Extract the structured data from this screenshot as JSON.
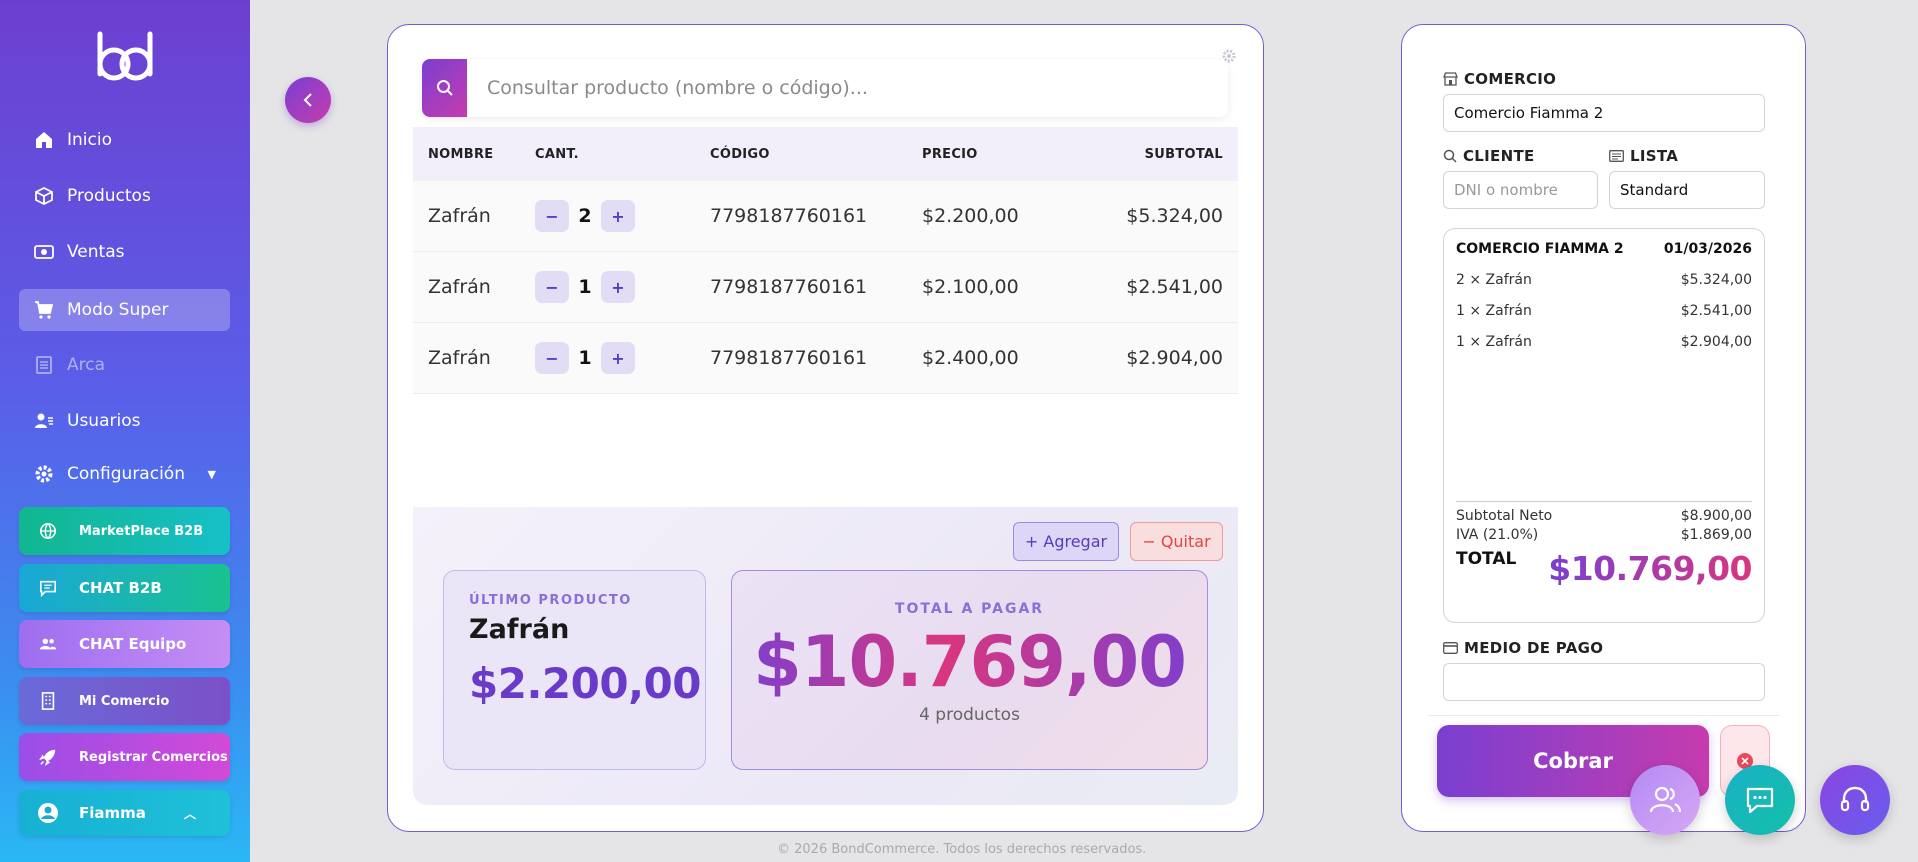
{
  "sidebar": {
    "logo": "bd",
    "items": [
      {
        "label": "Inicio",
        "icon": "home-icon"
      },
      {
        "label": "Productos",
        "icon": "box-icon"
      },
      {
        "label": "Ventas",
        "icon": "cash-icon"
      },
      {
        "label": "Modo Super",
        "icon": "cart-icon"
      },
      {
        "label": "Arca",
        "icon": "document-icon"
      },
      {
        "label": "Usuarios",
        "icon": "users-icon"
      },
      {
        "label": "Configuración",
        "icon": "gear-icon"
      }
    ],
    "pills": [
      {
        "label": "MarketPlace B2B",
        "icon": "globe-icon"
      },
      {
        "label": "CHAT B2B",
        "icon": "chat-icon"
      },
      {
        "label": "CHAT Equipo",
        "icon": "team-icon"
      },
      {
        "label": "Mi Comercio",
        "icon": "building-icon"
      },
      {
        "label": "Registrar Comercios",
        "icon": "rocket-icon"
      }
    ],
    "user": {
      "name": "Fiamma"
    }
  },
  "search": {
    "placeholder": "Consultar producto (nombre o código)..."
  },
  "table": {
    "headers": {
      "name": "NOMBRE",
      "qty": "CANT.",
      "code": "CÓDIGO",
      "price": "PRECIO",
      "subtotal": "SUBTOTAL"
    },
    "rows": [
      {
        "name": "Zafrán",
        "qty": "2",
        "code": "7798187760161",
        "price": "$2.200,00",
        "subtotal": "$5.324,00"
      },
      {
        "name": "Zafrán",
        "qty": "1",
        "code": "7798187760161",
        "price": "$2.100,00",
        "subtotal": "$2.541,00"
      },
      {
        "name": "Zafrán",
        "qty": "1",
        "code": "7798187760161",
        "price": "$2.400,00",
        "subtotal": "$2.904,00"
      }
    ],
    "minus": "−",
    "plus": "+"
  },
  "actions": {
    "add": "+ Agregar",
    "remove": "− Quitar"
  },
  "last_product": {
    "label": "ÚLTIMO PRODUCTO",
    "name": "Zafrán",
    "price": "$2.200,00"
  },
  "total": {
    "label": "TOTAL A PAGAR",
    "amount": "$10.769,00",
    "count": "4 productos"
  },
  "footer": "© 2026 BondCommerce. Todos los derechos reservados.",
  "right": {
    "commerce_label": "COMERCIO",
    "commerce_value": "Comercio Fiamma 2",
    "client_label": "CLIENTE",
    "client_placeholder": "DNI o nombre",
    "list_label": "LISTA",
    "list_value": "Standard",
    "ticket": {
      "store": "COMERCIO FIAMMA 2",
      "date": "01/03/2026",
      "items": [
        {
          "desc": "2 × Zafrán",
          "amount": "$5.324,00"
        },
        {
          "desc": "1 × Zafrán",
          "amount": "$2.541,00"
        },
        {
          "desc": "1 × Zafrán",
          "amount": "$2.904,00"
        }
      ],
      "subtotal_label": "Subtotal Neto",
      "subtotal": "$8.900,00",
      "iva_label": "IVA (21.0%)",
      "iva": "$1.869,00",
      "total_label": "TOTAL",
      "total": "$10.769,00"
    },
    "payment_label": "MEDIO DE PAGO",
    "payment_value": "",
    "charge_button": "Cobrar"
  },
  "colors": {
    "accent": "#7a3fd1",
    "accent2": "#c63cae",
    "pink": "#d9367f"
  }
}
